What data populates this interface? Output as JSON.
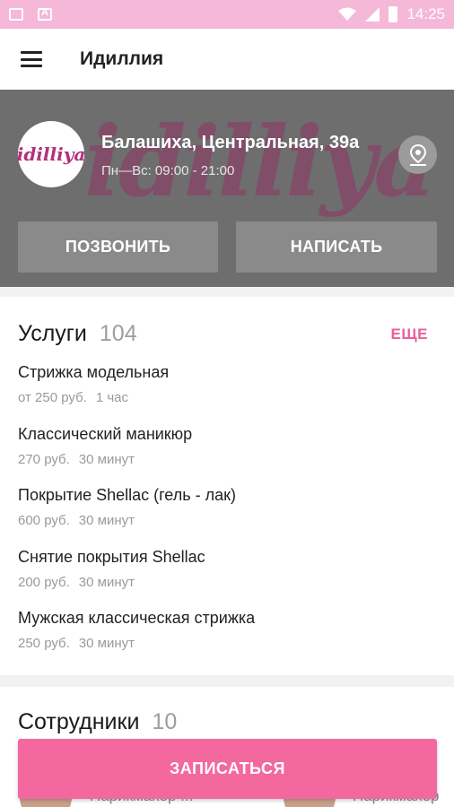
{
  "status_bar": {
    "time": "14:25",
    "icons": [
      "image-icon",
      "a-icon",
      "wifi-icon",
      "signal-icon",
      "battery-icon"
    ]
  },
  "app_bar": {
    "title": "Идиллия",
    "menu_icon": "hamburger-icon"
  },
  "salon": {
    "logo_text": "idilliya",
    "watermark_text": "idilliya",
    "address": "Балашиха, Центральная, 39а",
    "hours": "Пн—Вс: 09:00 - 21:00",
    "call_label": "ПОЗВОНИТЬ",
    "write_label": "НАПИСАТЬ",
    "map_icon": "location-pin-icon"
  },
  "services": {
    "title": "Услуги",
    "count": "104",
    "more_label": "ЕЩЕ",
    "items": [
      {
        "name": "Стрижка модельная",
        "price": "от 250 руб.",
        "duration": "1 час"
      },
      {
        "name": "Классический маникюр",
        "price": "270 руб.",
        "duration": "30 минут"
      },
      {
        "name": "Покрытие Shellac (гель - лак)",
        "price": "600 руб.",
        "duration": "30 минут"
      },
      {
        "name": "Снятие покрытия Shellac",
        "price": "200 руб.",
        "duration": "30 минут"
      },
      {
        "name": "Мужская классическая стрижка",
        "price": "250 руб.",
        "duration": "30 минут"
      }
    ]
  },
  "staff": {
    "title": "Сотрудники",
    "count": "10",
    "roles": [
      "Парикмахер ...",
      "Парикмахер"
    ]
  },
  "book_label": "ЗАПИСАТЬСЯ",
  "colors": {
    "status_bar": "#f5b8d8",
    "accent": "#f2689f",
    "more_link": "#e8609a",
    "hero_bg": "#6e6e6e"
  }
}
